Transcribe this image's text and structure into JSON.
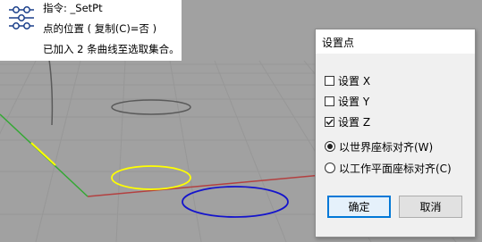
{
  "command": {
    "lines": [
      "指令: _SetPt",
      "点的位置 ( 复制(C)=否 )",
      "已加入 2 条曲线至选取集合。"
    ],
    "icon": "setpt-icon"
  },
  "dialog": {
    "title": "设置点",
    "checkboxes": [
      {
        "label": "设置 X",
        "checked": false
      },
      {
        "label": "设置 Y",
        "checked": false
      },
      {
        "label": "设置 Z",
        "checked": true
      }
    ],
    "radios": [
      {
        "label": "以世界座标对齐(W)",
        "selected": true
      },
      {
        "label": "以工作平面座标对齐(C)",
        "selected": false
      }
    ],
    "ok_label": "确定",
    "cancel_label": "取消"
  },
  "colors": {
    "viewport_bg": "#a1a1a1",
    "grid_line": "#989898",
    "x_axis": "#b34040",
    "y_axis": "#33a833",
    "curve_gray": "#5a5a5a",
    "curve_yellow": "#ffff00",
    "curve_blue": "#1414cc",
    "accent": "#0078d7"
  }
}
